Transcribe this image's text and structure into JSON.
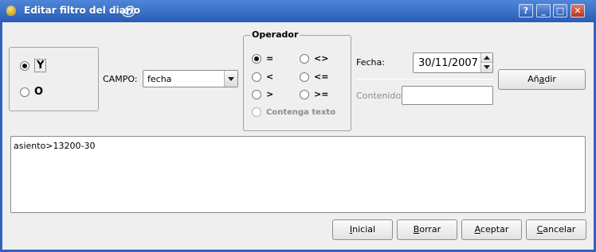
{
  "window": {
    "title": "Editar filtro del diario",
    "controls": {
      "help": "?",
      "minimize": "_",
      "maximize": "□",
      "close": "✕"
    },
    "icons": {
      "app": "money-bag-icon",
      "title_swirl": "swirl-icon"
    }
  },
  "logic": {
    "options": [
      {
        "label": "Y",
        "checked": true,
        "focused": true
      },
      {
        "label": "O",
        "checked": false
      }
    ]
  },
  "field": {
    "label": "CAMPO:",
    "value": "fecha"
  },
  "operator": {
    "title": "Operador",
    "options": [
      {
        "label": "=",
        "checked": true
      },
      {
        "label": "<>",
        "checked": false
      },
      {
        "label": "<",
        "checked": false
      },
      {
        "label": "<=",
        "checked": false
      },
      {
        "label": ">",
        "checked": false
      },
      {
        "label": ">=",
        "checked": false
      },
      {
        "label": "Contenga texto",
        "checked": false,
        "disabled": true
      }
    ]
  },
  "date": {
    "label": "Fecha:",
    "value": "30/11/2007"
  },
  "content": {
    "label": "Contenido:",
    "value": ""
  },
  "buttons": {
    "add": {
      "label": "Añadir",
      "mnemonic_index": 2
    },
    "initial": {
      "label": "Inicial",
      "mnemonic_index": 0
    },
    "delete": {
      "label": "Borrar",
      "mnemonic_index": 0
    },
    "accept": {
      "label": "Aceptar",
      "mnemonic_index": 0
    },
    "cancel": {
      "label": "Cancelar",
      "mnemonic_index": 0
    }
  },
  "filter_text": "asiento>13200-30",
  "colors": {
    "titlebar": "#2f62bd",
    "background": "#efefef"
  }
}
